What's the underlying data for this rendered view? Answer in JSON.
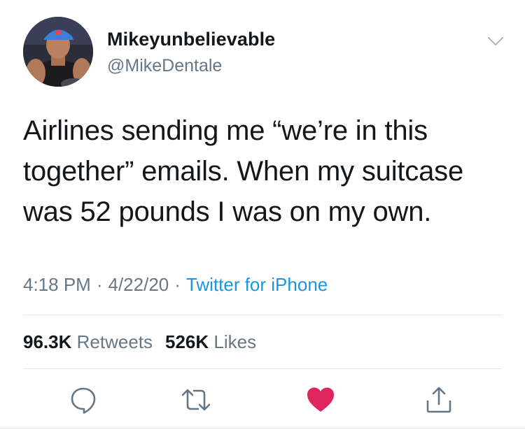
{
  "tweet": {
    "display_name": "Mikeyunbelievable",
    "handle": "@MikeDentale",
    "text": "Airlines sending me “we’re in this\ntogether” emails. When my suitcase\nwas 52 pounds I was on my own.",
    "time": "4:18 PM",
    "date": "4/22/20",
    "source": "Twitter for iPhone",
    "separator": "·"
  },
  "stats": {
    "retweets_count": "96.3K",
    "retweets_label": "Retweets",
    "likes_count": "526K",
    "likes_label": "Likes"
  },
  "actions": {
    "reply_icon": "reply-icon",
    "retweet_icon": "retweet-icon",
    "like_icon": "heart-icon",
    "share_icon": "share-icon"
  },
  "colors": {
    "text": "#14171a",
    "secondary": "#657786",
    "link": "#1b95e0",
    "like": "#e0245e",
    "divider": "#e1e8ed"
  }
}
